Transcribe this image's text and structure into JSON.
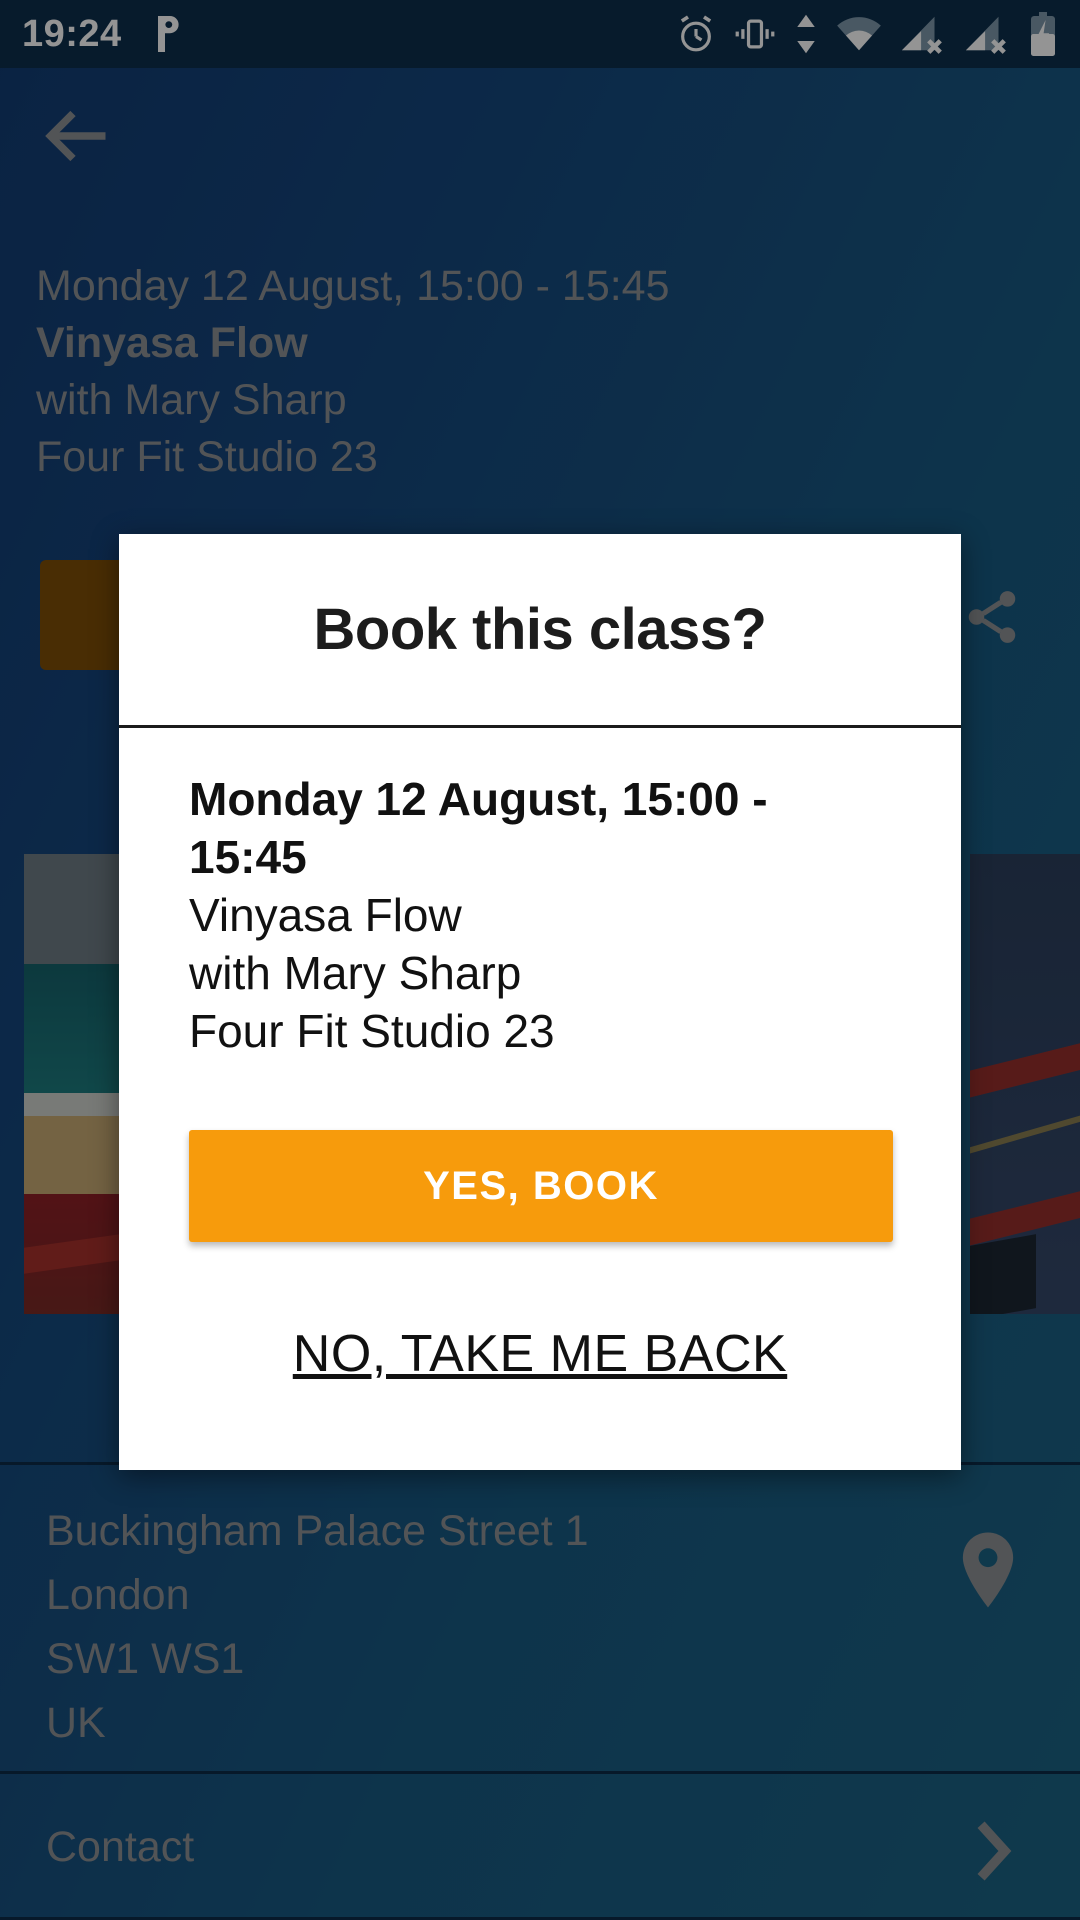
{
  "status_bar": {
    "time": "19:24",
    "left_icons": [
      "p-app-icon"
    ],
    "right_icons": [
      "alarm-icon",
      "vibrate-icon",
      "data-transfer-icon",
      "wifi-icon",
      "cellular-no-sim-1-icon",
      "cellular-no-sim-2-icon",
      "battery-charging-icon"
    ]
  },
  "toolbar": {
    "back_icon": "back-arrow-icon"
  },
  "class_header": {
    "datetime": "Monday 12 August, 15:00 - 15:45",
    "title": "Vinyasa Flow",
    "instructor": "with Mary Sharp",
    "studio": "Four Fit Studio 23",
    "share_icon": "share-icon"
  },
  "address": {
    "lines": [
      "Buckingham Palace Street 1",
      "London",
      "SW1 WS1",
      "UK"
    ],
    "map_icon": "map-pin-icon"
  },
  "contact": {
    "label": "Contact",
    "chevron_icon": "chevron-right-icon"
  },
  "dialog": {
    "title": "Book this class?",
    "detail_datetime": "Monday 12 August, 15:00 - 15:45",
    "detail_title": "Vinyasa Flow",
    "detail_instructor": "with Mary Sharp",
    "detail_studio": "Four Fit Studio 23",
    "confirm_label": "YES, BOOK",
    "cancel_label": "NO, TAKE ME BACK"
  },
  "colors": {
    "accent_orange": "#f79b0c",
    "background_blue": "#16477d",
    "status_bar": "#0d2f4d",
    "dialog_bg": "#ffffff",
    "muted_text": "#8e9295"
  }
}
